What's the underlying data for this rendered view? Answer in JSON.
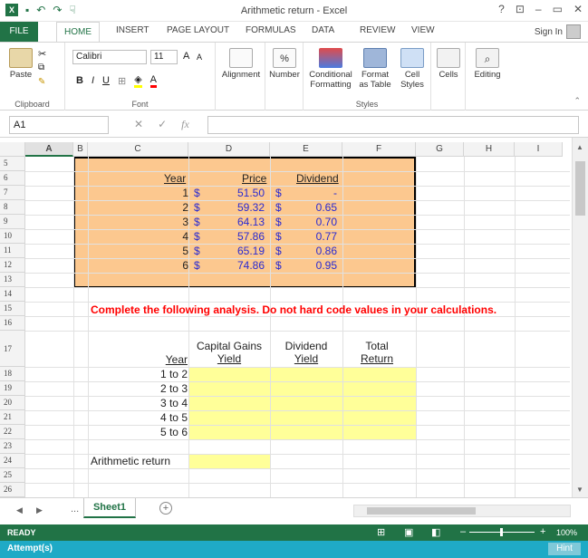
{
  "window": {
    "title": "Arithmetic return - Excel",
    "icons": [
      "excel-logo",
      "save-icon",
      "undo-icon",
      "redo-icon",
      "touch-icon"
    ],
    "controls": [
      "?",
      "⊡",
      "–",
      "▭",
      "✕"
    ]
  },
  "tabs": {
    "file": "FILE",
    "items": [
      "HOME",
      "INSERT",
      "PAGE LAYOUT",
      "FORMULAS",
      "DATA",
      "REVIEW",
      "VIEW"
    ],
    "active": "HOME",
    "sign_in": "Sign In"
  },
  "ribbon": {
    "clipboard": {
      "label": "Clipboard",
      "paste": "Paste"
    },
    "font": {
      "label": "Font",
      "name": "Calibri",
      "size": "11"
    },
    "alignment": "Alignment",
    "number": "Number",
    "styles": {
      "label": "Styles",
      "conditional": "Conditional Formatting",
      "format_table": "Format as Table",
      "cell_styles": "Cell Styles"
    },
    "cells": "Cells",
    "editing": "Editing"
  },
  "formula_bar": {
    "name_box": "A1",
    "fx": "fx",
    "value": ""
  },
  "columns": [
    "A",
    "B",
    "C",
    "D",
    "E",
    "F",
    "G",
    "H",
    "I"
  ],
  "rows": [
    "5",
    "6",
    "7",
    "8",
    "9",
    "10",
    "11",
    "12",
    "13",
    "14",
    "15",
    "16",
    "17",
    "18",
    "19",
    "20",
    "21",
    "22",
    "23",
    "24",
    "25",
    "26"
  ],
  "table1": {
    "headers": {
      "year": "Year",
      "price": "Price",
      "dividend": "Dividend"
    },
    "currency": "$",
    "rows": [
      {
        "year": "1",
        "price": "51.50",
        "dividend": "-"
      },
      {
        "year": "2",
        "price": "59.32",
        "dividend": "0.65"
      },
      {
        "year": "3",
        "price": "64.13",
        "dividend": "0.70"
      },
      {
        "year": "4",
        "price": "57.86",
        "dividend": "0.77"
      },
      {
        "year": "5",
        "price": "65.19",
        "dividend": "0.86"
      },
      {
        "year": "6",
        "price": "74.86",
        "dividend": "0.95"
      }
    ]
  },
  "instruction": "Complete the following analysis. Do not hard code values in your calculations.",
  "table2": {
    "col_year": "Year",
    "col_cg_1": "Capital Gains",
    "col_cg_2": "Yield",
    "col_div_1": "Dividend",
    "col_div_2": "Yield",
    "col_tot_1": "Total",
    "col_tot_2": "Return",
    "rows": [
      "1 to 2",
      "2 to 3",
      "3 to 4",
      "4 to 5",
      "5 to 6"
    ]
  },
  "arithmetic_return_label": "Arithmetic return",
  "sheet": {
    "tab": "Sheet1",
    "more": "...",
    "add": "+"
  },
  "status": {
    "ready": "READY",
    "zoom": "100%"
  },
  "attempt": {
    "label": "Attempt(s)",
    "hint": "Hint"
  },
  "colors": {
    "excel_green": "#217346",
    "orange_fill": "#fcc88f",
    "yellow_fill": "#ffff99",
    "instruction_red": "#ff0000",
    "value_blue": "#2a2ad1",
    "attempt_bar": "#1faac6"
  }
}
